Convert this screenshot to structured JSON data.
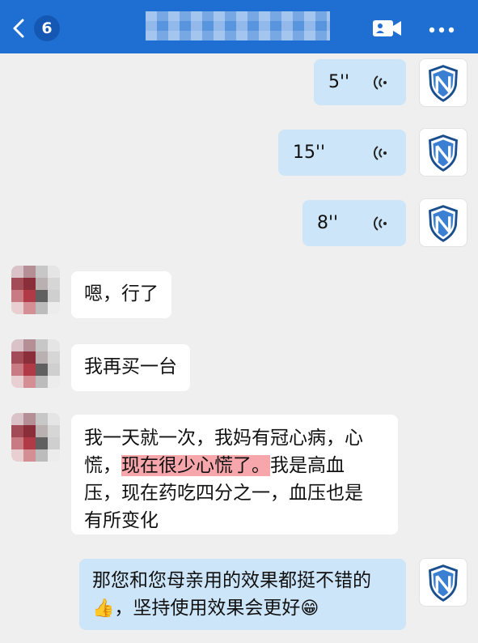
{
  "header": {
    "back_count": "6",
    "title_obscured": true,
    "accent_color": "#1f6fd3"
  },
  "messages": [
    {
      "side": "right",
      "type": "voice",
      "duration": "5''"
    },
    {
      "side": "right",
      "type": "voice",
      "duration": "15''"
    },
    {
      "side": "right",
      "type": "voice",
      "duration": "8''"
    },
    {
      "side": "left",
      "type": "text",
      "text": "嗯，行了"
    },
    {
      "side": "left",
      "type": "text",
      "text": "我再买一台"
    },
    {
      "side": "left",
      "type": "text",
      "line1": "我一天就一次，我妈有冠心病，心",
      "line2_pre": "慌，",
      "line2_highlight": "现在很少心慌了。",
      "line2_post": "我是高血",
      "line3": "压，现在药吃四分之一，血压也是",
      "line4": "有所变化"
    },
    {
      "side": "right",
      "type": "text",
      "line1": "那您和您母亲用的效果都挺不错的",
      "line2_emoji_start": "👍",
      "line2_text": "，坚持使用效果会更好",
      "line2_emoji_end": "😁"
    }
  ],
  "colors": {
    "outgoing_bubble": "#cde5f8",
    "incoming_bubble": "#ffffff",
    "highlight": "#f7a7ab",
    "background": "#efefef"
  },
  "icons": {
    "back": "chevron-left-icon",
    "video": "video-call-icon",
    "more": "more-dots-icon",
    "voice": "voice-wave-icon",
    "shield_avatar": "shield-logo-icon"
  }
}
